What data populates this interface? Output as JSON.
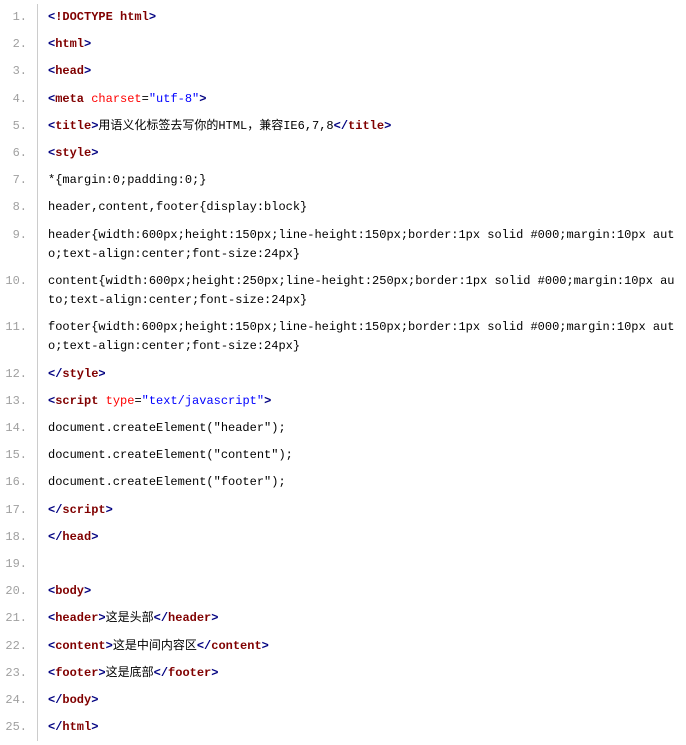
{
  "lines": [
    {
      "n": "1.",
      "segs": [
        {
          "c": "tag",
          "t": "<"
        },
        {
          "c": "tagname",
          "t": "!DOCTYPE html"
        },
        {
          "c": "tag",
          "t": ">"
        }
      ]
    },
    {
      "n": "2.",
      "segs": [
        {
          "c": "tag",
          "t": "<"
        },
        {
          "c": "tagname",
          "t": "html"
        },
        {
          "c": "tag",
          "t": ">"
        }
      ]
    },
    {
      "n": "3.",
      "segs": [
        {
          "c": "tag",
          "t": "<"
        },
        {
          "c": "tagname",
          "t": "head"
        },
        {
          "c": "tag",
          "t": ">"
        }
      ]
    },
    {
      "n": "4.",
      "segs": [
        {
          "c": "tag",
          "t": "<"
        },
        {
          "c": "tagname",
          "t": "meta"
        },
        {
          "c": "txt",
          "t": " "
        },
        {
          "c": "attr",
          "t": "charset"
        },
        {
          "c": "eq",
          "t": "="
        },
        {
          "c": "str",
          "t": "\"utf-8\""
        },
        {
          "c": "tag",
          "t": ">"
        }
      ]
    },
    {
      "n": "5.",
      "segs": [
        {
          "c": "tag",
          "t": "<"
        },
        {
          "c": "tagname",
          "t": "title"
        },
        {
          "c": "tag",
          "t": ">"
        },
        {
          "c": "txt",
          "t": "用语义化标签去写你的HTML，兼容IE6,7,8"
        },
        {
          "c": "tag",
          "t": "</"
        },
        {
          "c": "tagname",
          "t": "title"
        },
        {
          "c": "tag",
          "t": ">"
        }
      ]
    },
    {
      "n": "6.",
      "segs": [
        {
          "c": "tag",
          "t": "<"
        },
        {
          "c": "tagname",
          "t": "style"
        },
        {
          "c": "tag",
          "t": ">"
        }
      ]
    },
    {
      "n": "7.",
      "segs": [
        {
          "c": "txt",
          "t": "*{margin:0;padding:0;}"
        }
      ]
    },
    {
      "n": "8.",
      "segs": [
        {
          "c": "txt",
          "t": "header,content,footer{display:block}"
        }
      ]
    },
    {
      "n": "9.",
      "segs": [
        {
          "c": "txt",
          "t": "header{width:600px;height:150px;line-height:150px;border:1px solid #000;margin:10px auto;text-align:center;font-size:24px}"
        }
      ]
    },
    {
      "n": "10.",
      "segs": [
        {
          "c": "txt",
          "t": "content{width:600px;height:250px;line-height:250px;border:1px solid #000;margin:10px auto;text-align:center;font-size:24px}"
        }
      ]
    },
    {
      "n": "11.",
      "segs": [
        {
          "c": "txt",
          "t": "footer{width:600px;height:150px;line-height:150px;border:1px solid #000;margin:10px auto;text-align:center;font-size:24px}"
        }
      ]
    },
    {
      "n": "12.",
      "segs": [
        {
          "c": "tag",
          "t": "</"
        },
        {
          "c": "tagname",
          "t": "style"
        },
        {
          "c": "tag",
          "t": ">"
        }
      ]
    },
    {
      "n": "13.",
      "segs": [
        {
          "c": "tag",
          "t": "<"
        },
        {
          "c": "tagname",
          "t": "script"
        },
        {
          "c": "txt",
          "t": " "
        },
        {
          "c": "attr",
          "t": "type"
        },
        {
          "c": "eq",
          "t": "="
        },
        {
          "c": "str",
          "t": "\"text/javascript\""
        },
        {
          "c": "tag",
          "t": ">"
        }
      ]
    },
    {
      "n": "14.",
      "segs": [
        {
          "c": "txt",
          "t": "document.createElement(\"header\");"
        }
      ]
    },
    {
      "n": "15.",
      "segs": [
        {
          "c": "txt",
          "t": "document.createElement(\"content\");"
        }
      ]
    },
    {
      "n": "16.",
      "segs": [
        {
          "c": "txt",
          "t": "document.createElement(\"footer\");"
        }
      ]
    },
    {
      "n": "17.",
      "segs": [
        {
          "c": "tag",
          "t": "</"
        },
        {
          "c": "tagname",
          "t": "script"
        },
        {
          "c": "tag",
          "t": ">"
        }
      ]
    },
    {
      "n": "18.",
      "segs": [
        {
          "c": "tag",
          "t": "</"
        },
        {
          "c": "tagname",
          "t": "head"
        },
        {
          "c": "tag",
          "t": ">"
        }
      ]
    },
    {
      "n": "19.",
      "segs": [
        {
          "c": "txt",
          "t": " "
        }
      ]
    },
    {
      "n": "20.",
      "segs": [
        {
          "c": "tag",
          "t": "<"
        },
        {
          "c": "tagname",
          "t": "body"
        },
        {
          "c": "tag",
          "t": ">"
        }
      ]
    },
    {
      "n": "21.",
      "segs": [
        {
          "c": "tag",
          "t": "<"
        },
        {
          "c": "tagname",
          "t": "header"
        },
        {
          "c": "tag",
          "t": ">"
        },
        {
          "c": "txt",
          "t": "这是头部"
        },
        {
          "c": "tag",
          "t": "</"
        },
        {
          "c": "tagname",
          "t": "header"
        },
        {
          "c": "tag",
          "t": ">"
        }
      ]
    },
    {
      "n": "22.",
      "segs": [
        {
          "c": "tag",
          "t": "<"
        },
        {
          "c": "tagname",
          "t": "content"
        },
        {
          "c": "tag",
          "t": ">"
        },
        {
          "c": "txt",
          "t": "这是中间内容区"
        },
        {
          "c": "tag",
          "t": "</"
        },
        {
          "c": "tagname",
          "t": "content"
        },
        {
          "c": "tag",
          "t": ">"
        }
      ]
    },
    {
      "n": "23.",
      "segs": [
        {
          "c": "tag",
          "t": "<"
        },
        {
          "c": "tagname",
          "t": "footer"
        },
        {
          "c": "tag",
          "t": ">"
        },
        {
          "c": "txt",
          "t": "这是底部"
        },
        {
          "c": "tag",
          "t": "</"
        },
        {
          "c": "tagname",
          "t": "footer"
        },
        {
          "c": "tag",
          "t": ">"
        }
      ]
    },
    {
      "n": "24.",
      "segs": [
        {
          "c": "tag",
          "t": "</"
        },
        {
          "c": "tagname",
          "t": "body"
        },
        {
          "c": "tag",
          "t": ">"
        }
      ]
    },
    {
      "n": "25.",
      "segs": [
        {
          "c": "tag",
          "t": "</"
        },
        {
          "c": "tagname",
          "t": "html"
        },
        {
          "c": "tag",
          "t": ">"
        }
      ]
    }
  ]
}
